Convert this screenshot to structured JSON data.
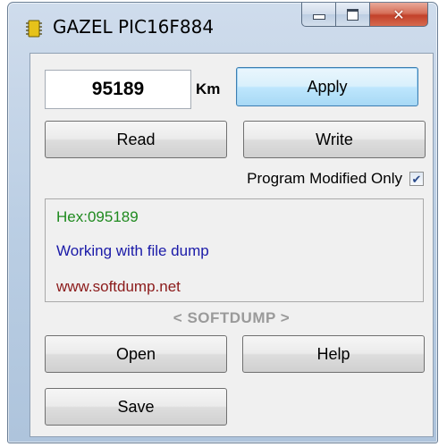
{
  "window": {
    "title": "GAZEL PIC16F884",
    "icon": "chip-icon"
  },
  "mileage": {
    "value": "95189",
    "unit": "Km"
  },
  "buttons": {
    "apply": "Apply",
    "read": "Read",
    "write": "Write",
    "open": "Open",
    "help": "Help",
    "save": "Save"
  },
  "option": {
    "label": "Program Modified Only",
    "checked": true
  },
  "info": {
    "hex": "Hex:095189",
    "status": "Working with file dump",
    "url": "www.softdump.net",
    "colors": {
      "hex": "#1f8a1f",
      "status": "#1a1aa8",
      "url": "#8b1a1a"
    }
  },
  "brand": "< SOFTDUMP >"
}
